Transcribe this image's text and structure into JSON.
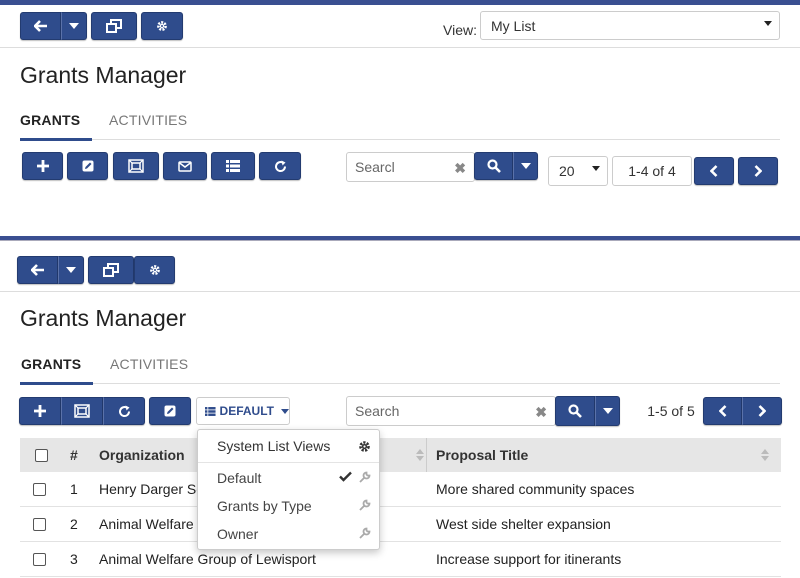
{
  "colors": {
    "accent": "#2f4c8c",
    "header_bg": "#e6e6e6"
  },
  "top": {
    "toolbar": {
      "back_icon": "arrow-left-icon",
      "dropdown_icon": "caret-down-icon",
      "window_icon": "restore-window-icon",
      "settings_icon": "gear-icon"
    },
    "view_label": "View:",
    "view_value": "My List",
    "title": "Grants Manager",
    "tabs": [
      {
        "label": "GRANTS",
        "active": true
      },
      {
        "label": "ACTIVITIES",
        "active": false
      }
    ],
    "actions": [
      "plus-icon",
      "edit-icon",
      "expand-icon",
      "mail-icon",
      "list-icon",
      "refresh-icon"
    ],
    "search_placeholder": "Searcl",
    "page_size": "20",
    "range": "1-4 of 4"
  },
  "bottom": {
    "title": "Grants Manager",
    "tabs": [
      {
        "label": "GRANTS",
        "active": true
      },
      {
        "label": "ACTIVITIES",
        "active": false
      }
    ],
    "actions": [
      "plus-icon",
      "expand-icon",
      "refresh-icon",
      "edit-icon"
    ],
    "default_label": "DEFAULT",
    "search_placeholder": "Search",
    "range": "1-5 of 5",
    "columns": {
      "num": "#",
      "org": "Organization",
      "title": "Proposal Title"
    },
    "rows": [
      {
        "num": "1",
        "org": "Henry Darger Sc",
        "title": "More shared community spaces"
      },
      {
        "num": "2",
        "org": "Animal Welfare",
        "title": "West side shelter expansion"
      },
      {
        "num": "3",
        "org": "Animal Welfare Group of Lewisport",
        "title": "Increase support for itinerants"
      }
    ],
    "menu": {
      "header": "System List Views",
      "items": [
        {
          "label": "Default",
          "selected": true
        },
        {
          "label": "Grants by Type",
          "selected": false
        },
        {
          "label": "Owner",
          "selected": false
        }
      ]
    }
  }
}
